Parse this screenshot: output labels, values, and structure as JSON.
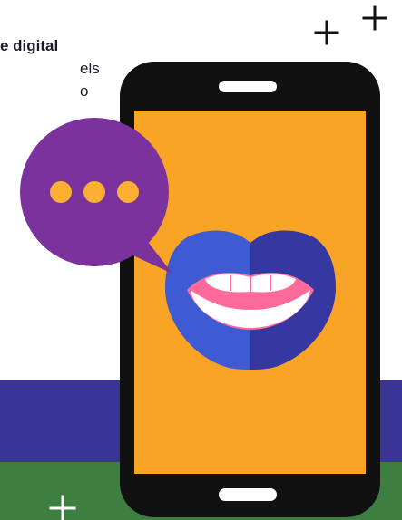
{
  "text_fragment": {
    "line1": "e digital",
    "line2": "els",
    "line3": "o"
  },
  "colors": {
    "phone_body": "#111111",
    "phone_screen": "#f9a425",
    "speech_bubble": "#7b329c",
    "bubble_dots": "#fbb034",
    "lips_left": "#3f5bd3",
    "lips_right": "#3438a0",
    "gums": "#ff6a9d",
    "band_purple": "#3a3594",
    "band_green": "#3d7f41"
  },
  "icons": [
    "plus-icon",
    "smartphone-icon",
    "speech-bubble-icon",
    "ellipsis-icon",
    "lips-icon"
  ]
}
